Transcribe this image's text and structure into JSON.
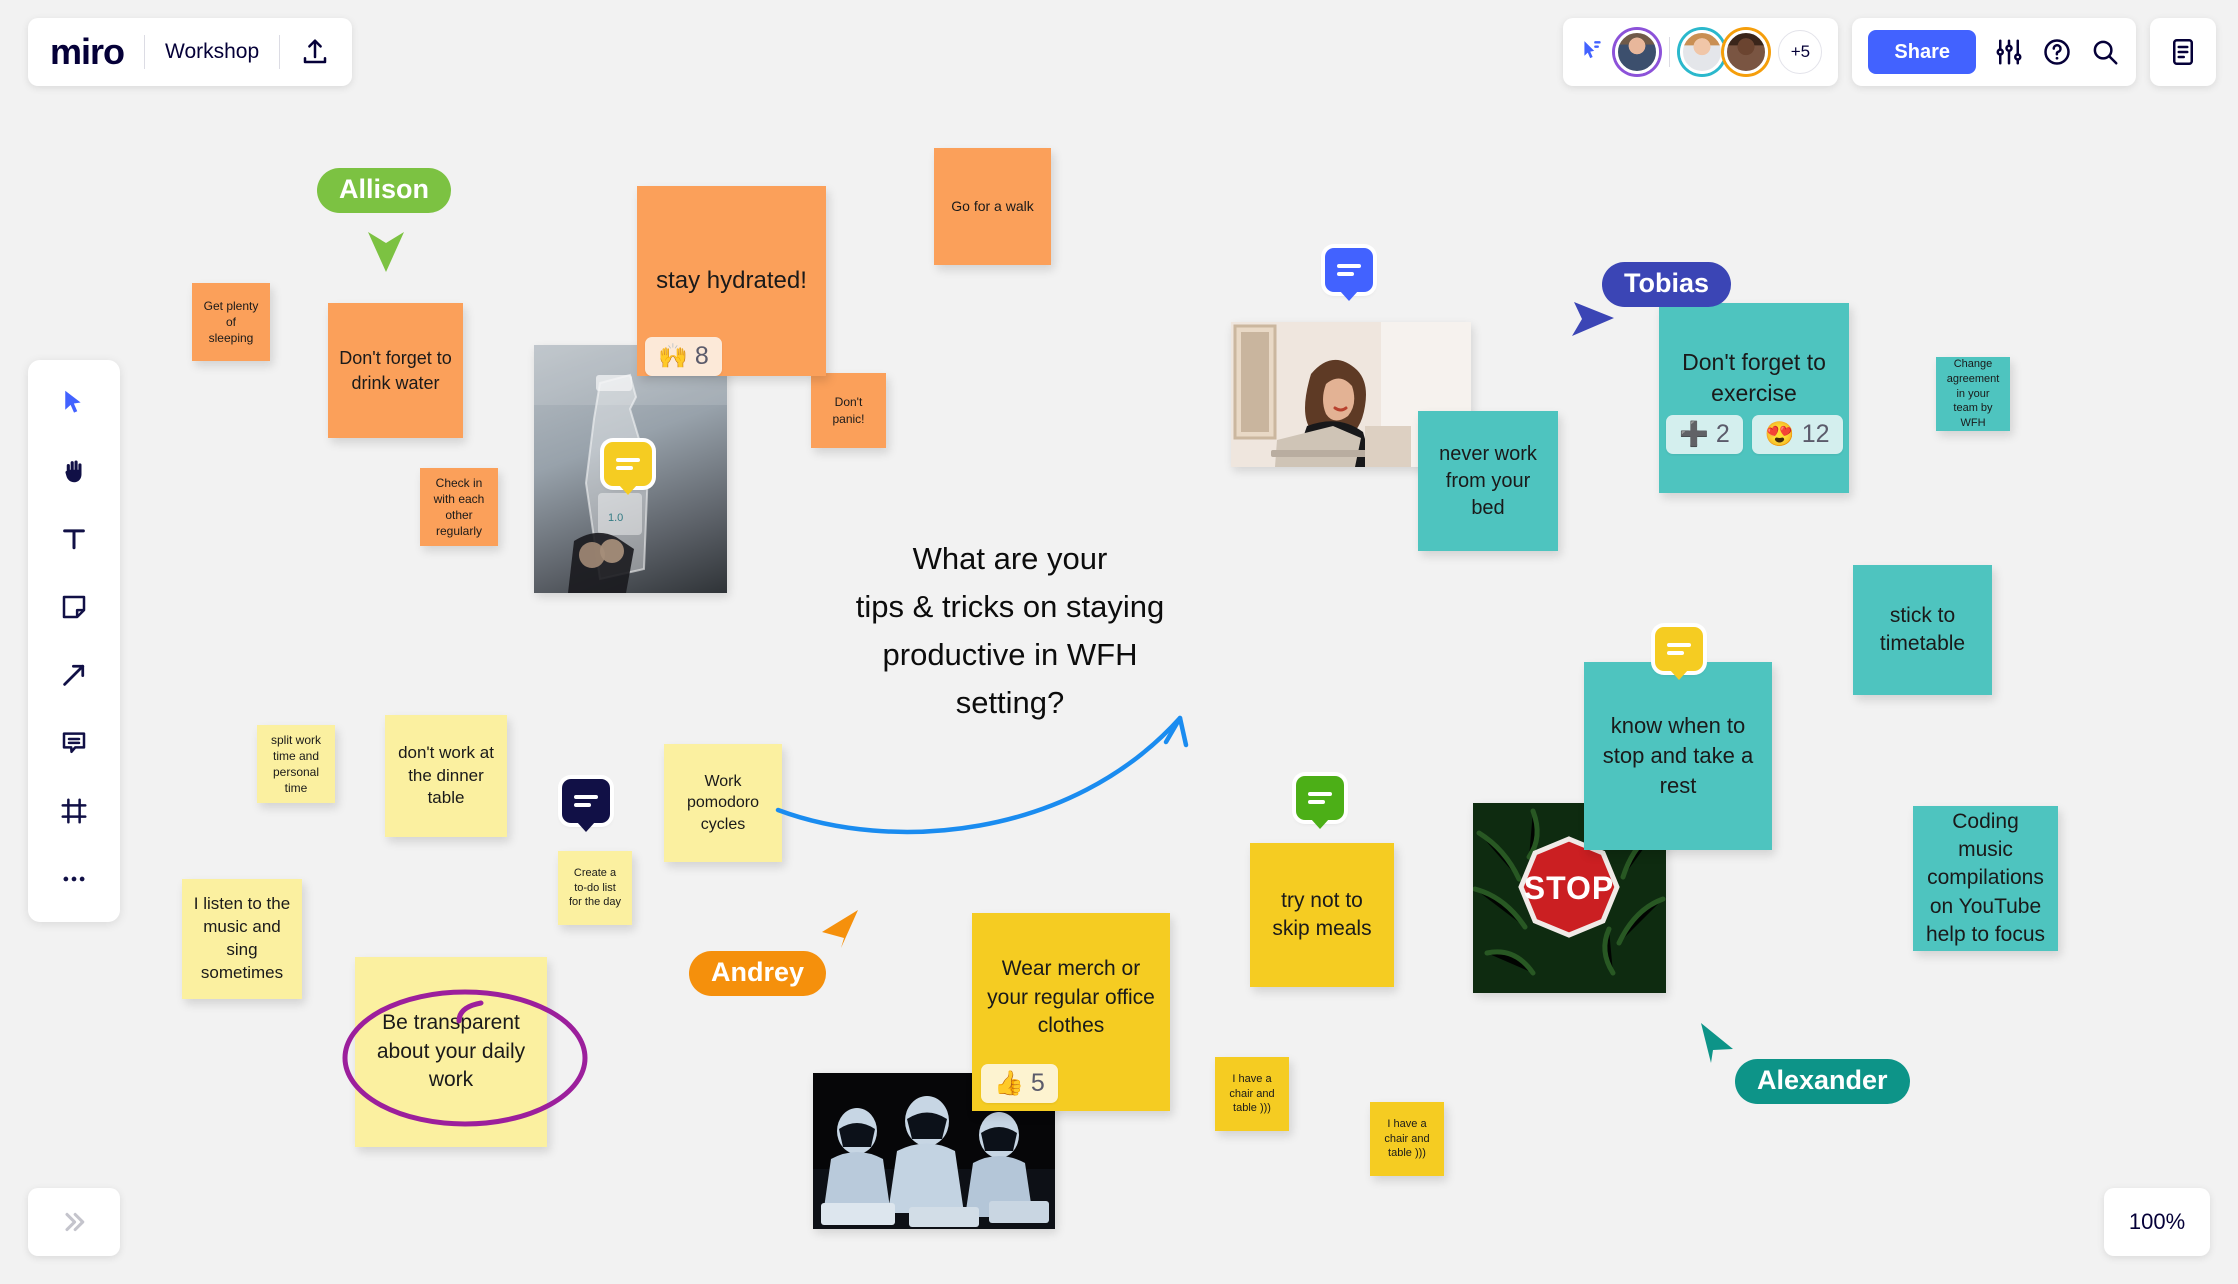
{
  "app": {
    "brand": "miro",
    "board_title": "Workshop",
    "zoom_level": "100%",
    "share_label": "Share",
    "avatar_overflow": "+5"
  },
  "top_right_icons": [
    {
      "name": "follow-cursor-icon"
    },
    {
      "name": "settings-sliders-icon"
    },
    {
      "name": "help-icon"
    },
    {
      "name": "search-icon"
    },
    {
      "name": "notes-panel-icon"
    }
  ],
  "toolbar": {
    "items": [
      {
        "name": "select-tool",
        "icon": "cursor-icon"
      },
      {
        "name": "hand-tool",
        "icon": "hand-icon"
      },
      {
        "name": "text-tool",
        "icon": "text-icon"
      },
      {
        "name": "sticky-note-tool",
        "icon": "sticky-note-icon"
      },
      {
        "name": "arrow-tool",
        "icon": "arrow-icon"
      },
      {
        "name": "comment-tool",
        "icon": "comment-icon"
      },
      {
        "name": "frame-tool",
        "icon": "frame-icon"
      },
      {
        "name": "more-tool",
        "icon": "ellipsis-icon"
      }
    ]
  },
  "canvas": {
    "central_question": "What are your\ntips & tricks on staying\nproductive in WFH\nsetting?",
    "notes": [
      {
        "id": "get-plenty-sleeping",
        "text": "Get plenty of sleeping",
        "color": "#fba05a"
      },
      {
        "id": "dont-forget-drink-water",
        "text": "Don't forget to drink water",
        "color": "#fba05a"
      },
      {
        "id": "check-in-regularly",
        "text": "Check in with each other regularly",
        "color": "#fba05a"
      },
      {
        "id": "stay-hydrated",
        "text": "stay hydrated!",
        "color": "#fba05a"
      },
      {
        "id": "dont-panic",
        "text": "Don't panic!",
        "color": "#fba05a"
      },
      {
        "id": "go-for-a-walk",
        "text": "Go for a walk",
        "color": "#fba05a"
      },
      {
        "id": "never-work-from-bed",
        "text": "never work from your bed",
        "color": "#4ec4bf"
      },
      {
        "id": "dont-forget-exercise",
        "text": "Don't forget to exercise",
        "color": "#4ec4bf"
      },
      {
        "id": "change-agreement",
        "text": "Change agreement  in your team by WFH",
        "color": "#4ec4bf"
      },
      {
        "id": "stick-to-timetable",
        "text": "stick to timetable",
        "color": "#4ec4bf"
      },
      {
        "id": "know-when-to-stop",
        "text": "know when to stop and take a rest",
        "color": "#4ec4bf"
      },
      {
        "id": "coding-music",
        "text": "Coding music compilations on YouTube help to focus",
        "color": "#4ec4bf"
      },
      {
        "id": "split-work-time",
        "text": "split work time and personal time",
        "color": "#fbf0a0"
      },
      {
        "id": "dont-work-dinner-table",
        "text": "don't work at the dinner table",
        "color": "#fbf0a0"
      },
      {
        "id": "create-todo-list",
        "text": "Create a to-do list for the day",
        "color": "#fbf0a0"
      },
      {
        "id": "listen-to-music",
        "text": "I listen to the music and sing sometimes",
        "color": "#fbf0a0"
      },
      {
        "id": "work-pomodoro",
        "text": "Work pomodoro cycles",
        "color": "#fbf0a0"
      },
      {
        "id": "be-transparent",
        "text": "Be transparent about your daily work",
        "color": "#fbf0a0"
      },
      {
        "id": "try-not-skip-meals",
        "text": "try not to skip meals",
        "color": "#f5cc22"
      },
      {
        "id": "wear-merch",
        "text": "Wear merch or your regular office clothes",
        "color": "#f5cc22"
      },
      {
        "id": "chair-table-1",
        "text": "I have a chair and table )))",
        "color": "#f5cc22"
      },
      {
        "id": "chair-table-2",
        "text": "I have a chair and table )))",
        "color": "#f5cc22"
      }
    ],
    "reactions": [
      {
        "note": "stay-hydrated",
        "emoji": "🙌",
        "count": "8"
      },
      {
        "note": "dont-forget-exercise",
        "emoji": "➕",
        "count": "2"
      },
      {
        "note": "dont-forget-exercise-2",
        "emoji": "😍",
        "count": "12"
      },
      {
        "note": "wear-merch",
        "emoji": "👍",
        "count": "5"
      }
    ],
    "collaborators": [
      {
        "name": "Allison",
        "color": "#7cc242",
        "text_color": "#ffffff"
      },
      {
        "name": "Tobias",
        "color": "#3b45b5",
        "text_color": "#ffffff"
      },
      {
        "name": "Andrey",
        "color": "#f5900c",
        "text_color": "#ffffff"
      },
      {
        "name": "Alexander",
        "color": "#0d9488",
        "text_color": "#ffffff"
      }
    ],
    "comment_pins": [
      {
        "id": "pin-yellow-bottle",
        "color": "#f5cc22"
      },
      {
        "id": "pin-blue-woman",
        "color": "#4262ff"
      },
      {
        "id": "pin-navy-dinner",
        "color": "#111046"
      },
      {
        "id": "pin-green-meals",
        "color": "#4caf17"
      },
      {
        "id": "pin-yellow-rest",
        "color": "#f5cc22"
      }
    ],
    "images": [
      {
        "id": "water-bottle-photo",
        "alt": "hand holding water bottle"
      },
      {
        "id": "woman-laptop-photo",
        "alt": "woman working on laptop in bed"
      },
      {
        "id": "stop-sign-photo",
        "alt": "red stop sign in green leaves"
      },
      {
        "id": "stormtroopers-photo",
        "alt": "stormtroopers at laptops"
      }
    ]
  },
  "colors": {
    "accent": "#4262ff",
    "brand_dark": "#050038",
    "orange_note": "#fba05a",
    "teal_note": "#4ec4bf",
    "yellow_note": "#fbf0a0",
    "gold_note": "#f5cc22",
    "canvas_bg": "#f2f2f2"
  }
}
